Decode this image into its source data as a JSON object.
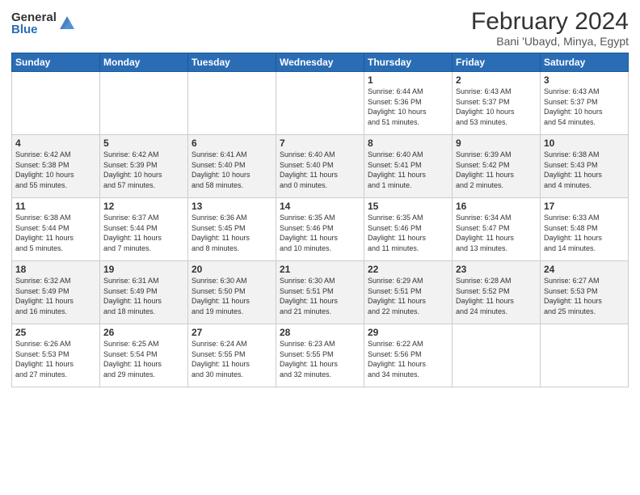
{
  "header": {
    "logo_general": "General",
    "logo_blue": "Blue",
    "month_title": "February 2024",
    "location": "Bani 'Ubayd, Minya, Egypt"
  },
  "days_of_week": [
    "Sunday",
    "Monday",
    "Tuesday",
    "Wednesday",
    "Thursday",
    "Friday",
    "Saturday"
  ],
  "weeks": [
    [
      {
        "day": "",
        "info": ""
      },
      {
        "day": "",
        "info": ""
      },
      {
        "day": "",
        "info": ""
      },
      {
        "day": "",
        "info": ""
      },
      {
        "day": "1",
        "info": "Sunrise: 6:44 AM\nSunset: 5:36 PM\nDaylight: 10 hours\nand 51 minutes."
      },
      {
        "day": "2",
        "info": "Sunrise: 6:43 AM\nSunset: 5:37 PM\nDaylight: 10 hours\nand 53 minutes."
      },
      {
        "day": "3",
        "info": "Sunrise: 6:43 AM\nSunset: 5:37 PM\nDaylight: 10 hours\nand 54 minutes."
      }
    ],
    [
      {
        "day": "4",
        "info": "Sunrise: 6:42 AM\nSunset: 5:38 PM\nDaylight: 10 hours\nand 55 minutes."
      },
      {
        "day": "5",
        "info": "Sunrise: 6:42 AM\nSunset: 5:39 PM\nDaylight: 10 hours\nand 57 minutes."
      },
      {
        "day": "6",
        "info": "Sunrise: 6:41 AM\nSunset: 5:40 PM\nDaylight: 10 hours\nand 58 minutes."
      },
      {
        "day": "7",
        "info": "Sunrise: 6:40 AM\nSunset: 5:40 PM\nDaylight: 11 hours\nand 0 minutes."
      },
      {
        "day": "8",
        "info": "Sunrise: 6:40 AM\nSunset: 5:41 PM\nDaylight: 11 hours\nand 1 minute."
      },
      {
        "day": "9",
        "info": "Sunrise: 6:39 AM\nSunset: 5:42 PM\nDaylight: 11 hours\nand 2 minutes."
      },
      {
        "day": "10",
        "info": "Sunrise: 6:38 AM\nSunset: 5:43 PM\nDaylight: 11 hours\nand 4 minutes."
      }
    ],
    [
      {
        "day": "11",
        "info": "Sunrise: 6:38 AM\nSunset: 5:44 PM\nDaylight: 11 hours\nand 5 minutes."
      },
      {
        "day": "12",
        "info": "Sunrise: 6:37 AM\nSunset: 5:44 PM\nDaylight: 11 hours\nand 7 minutes."
      },
      {
        "day": "13",
        "info": "Sunrise: 6:36 AM\nSunset: 5:45 PM\nDaylight: 11 hours\nand 8 minutes."
      },
      {
        "day": "14",
        "info": "Sunrise: 6:35 AM\nSunset: 5:46 PM\nDaylight: 11 hours\nand 10 minutes."
      },
      {
        "day": "15",
        "info": "Sunrise: 6:35 AM\nSunset: 5:46 PM\nDaylight: 11 hours\nand 11 minutes."
      },
      {
        "day": "16",
        "info": "Sunrise: 6:34 AM\nSunset: 5:47 PM\nDaylight: 11 hours\nand 13 minutes."
      },
      {
        "day": "17",
        "info": "Sunrise: 6:33 AM\nSunset: 5:48 PM\nDaylight: 11 hours\nand 14 minutes."
      }
    ],
    [
      {
        "day": "18",
        "info": "Sunrise: 6:32 AM\nSunset: 5:49 PM\nDaylight: 11 hours\nand 16 minutes."
      },
      {
        "day": "19",
        "info": "Sunrise: 6:31 AM\nSunset: 5:49 PM\nDaylight: 11 hours\nand 18 minutes."
      },
      {
        "day": "20",
        "info": "Sunrise: 6:30 AM\nSunset: 5:50 PM\nDaylight: 11 hours\nand 19 minutes."
      },
      {
        "day": "21",
        "info": "Sunrise: 6:30 AM\nSunset: 5:51 PM\nDaylight: 11 hours\nand 21 minutes."
      },
      {
        "day": "22",
        "info": "Sunrise: 6:29 AM\nSunset: 5:51 PM\nDaylight: 11 hours\nand 22 minutes."
      },
      {
        "day": "23",
        "info": "Sunrise: 6:28 AM\nSunset: 5:52 PM\nDaylight: 11 hours\nand 24 minutes."
      },
      {
        "day": "24",
        "info": "Sunrise: 6:27 AM\nSunset: 5:53 PM\nDaylight: 11 hours\nand 25 minutes."
      }
    ],
    [
      {
        "day": "25",
        "info": "Sunrise: 6:26 AM\nSunset: 5:53 PM\nDaylight: 11 hours\nand 27 minutes."
      },
      {
        "day": "26",
        "info": "Sunrise: 6:25 AM\nSunset: 5:54 PM\nDaylight: 11 hours\nand 29 minutes."
      },
      {
        "day": "27",
        "info": "Sunrise: 6:24 AM\nSunset: 5:55 PM\nDaylight: 11 hours\nand 30 minutes."
      },
      {
        "day": "28",
        "info": "Sunrise: 6:23 AM\nSunset: 5:55 PM\nDaylight: 11 hours\nand 32 minutes."
      },
      {
        "day": "29",
        "info": "Sunrise: 6:22 AM\nSunset: 5:56 PM\nDaylight: 11 hours\nand 34 minutes."
      },
      {
        "day": "",
        "info": ""
      },
      {
        "day": "",
        "info": ""
      }
    ]
  ]
}
